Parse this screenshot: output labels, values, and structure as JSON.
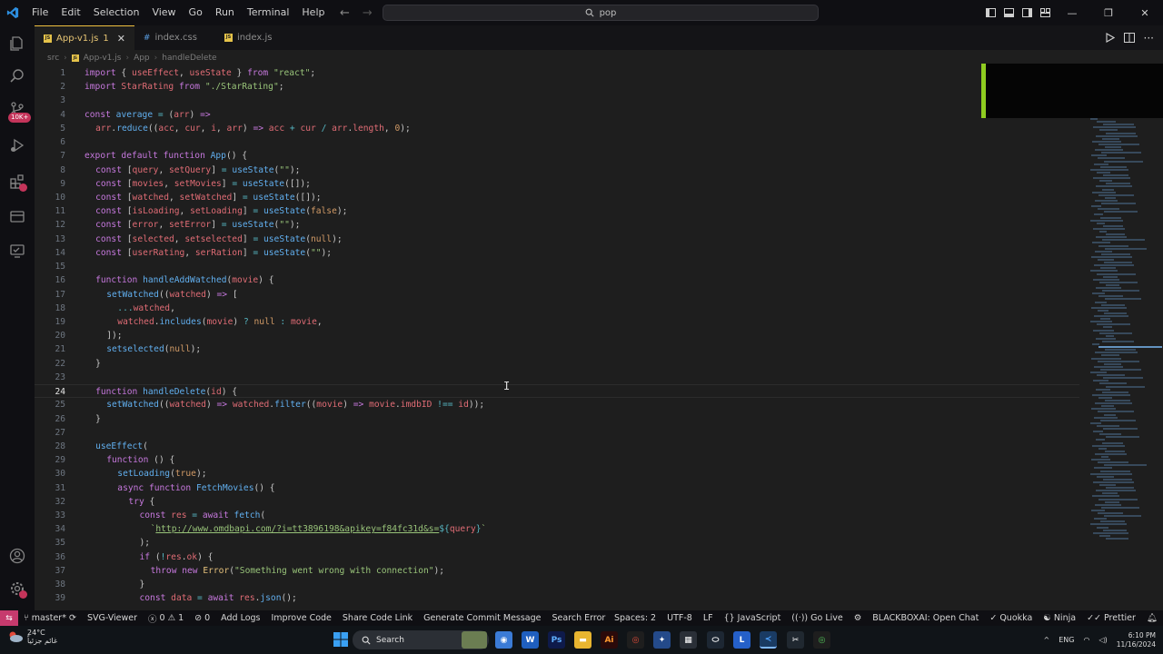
{
  "titlebar": {
    "menu": [
      "File",
      "Edit",
      "Selection",
      "View",
      "Go",
      "Run",
      "Terminal",
      "Help"
    ],
    "search_text": "pop"
  },
  "activity": {
    "badge_source": "10K+"
  },
  "tabs": [
    {
      "label": "App-v1.js",
      "modified": "1",
      "type": "js",
      "active": true
    },
    {
      "label": "index.css",
      "type": "css",
      "active": false
    },
    {
      "label": "index.js",
      "type": "js",
      "active": false
    }
  ],
  "breadcrumb": [
    "src",
    "App-v1.js",
    "App",
    "handleDelete"
  ],
  "editor": {
    "current_line": 24,
    "lines": [
      {
        "n": 1,
        "i": 0,
        "t": [
          [
            "kw",
            "import"
          ],
          [
            "df",
            " { "
          ],
          [
            "vr",
            "useEffect"
          ],
          [
            "df",
            ", "
          ],
          [
            "vr",
            "useState"
          ],
          [
            "df",
            " } "
          ],
          [
            "kw",
            "from"
          ],
          [
            "st",
            " \"react\""
          ],
          [
            "df",
            ";"
          ]
        ]
      },
      {
        "n": 2,
        "i": 0,
        "t": [
          [
            "kw",
            "import"
          ],
          [
            "vr",
            " StarRating "
          ],
          [
            "kw",
            "from"
          ],
          [
            "st",
            " \"./StarRating\""
          ],
          [
            "df",
            ";"
          ]
        ]
      },
      {
        "n": 3,
        "i": 0,
        "t": []
      },
      {
        "n": 4,
        "i": 0,
        "t": [
          [
            "kw",
            "const"
          ],
          [
            "fn",
            " average"
          ],
          [
            "op",
            " = "
          ],
          [
            "df",
            "("
          ],
          [
            "vr",
            "arr"
          ],
          [
            "df",
            ") "
          ],
          [
            "kw",
            "=>"
          ]
        ]
      },
      {
        "n": 5,
        "i": 1,
        "t": [
          [
            "vr",
            "arr"
          ],
          [
            "df",
            "."
          ],
          [
            "fn",
            "reduce"
          ],
          [
            "df",
            "(("
          ],
          [
            "vr",
            "acc"
          ],
          [
            "df",
            ", "
          ],
          [
            "vr",
            "cur"
          ],
          [
            "df",
            ", "
          ],
          [
            "vr",
            "i"
          ],
          [
            "df",
            ", "
          ],
          [
            "vr",
            "arr"
          ],
          [
            "df",
            ") "
          ],
          [
            "kw",
            "=>"
          ],
          [
            "vr",
            " acc "
          ],
          [
            "op",
            "+"
          ],
          [
            "vr",
            " cur "
          ],
          [
            "op",
            "/"
          ],
          [
            "vr",
            " arr"
          ],
          [
            "df",
            "."
          ],
          [
            "vr",
            "length"
          ],
          [
            "df",
            ", "
          ],
          [
            "nu",
            "0"
          ],
          [
            "df",
            ");"
          ]
        ]
      },
      {
        "n": 6,
        "i": 0,
        "t": []
      },
      {
        "n": 7,
        "i": 0,
        "t": [
          [
            "kw",
            "export default function "
          ],
          [
            "fn",
            "App"
          ],
          [
            "df",
            "() {"
          ]
        ]
      },
      {
        "n": 8,
        "i": 1,
        "t": [
          [
            "kw",
            "const"
          ],
          [
            "df",
            " ["
          ],
          [
            "vr",
            "query"
          ],
          [
            "df",
            ", "
          ],
          [
            "vr",
            "setQuery"
          ],
          [
            "df",
            "] "
          ],
          [
            "op",
            "="
          ],
          [
            "fn",
            " useState"
          ],
          [
            "df",
            "("
          ],
          [
            "st",
            "\"\""
          ],
          [
            "df",
            ");"
          ]
        ]
      },
      {
        "n": 9,
        "i": 1,
        "t": [
          [
            "kw",
            "const"
          ],
          [
            "df",
            " ["
          ],
          [
            "vr",
            "movies"
          ],
          [
            "df",
            ", "
          ],
          [
            "vr",
            "setMovies"
          ],
          [
            "df",
            "] "
          ],
          [
            "op",
            "="
          ],
          [
            "fn",
            " useState"
          ],
          [
            "df",
            "([]);"
          ]
        ]
      },
      {
        "n": 10,
        "i": 1,
        "t": [
          [
            "kw",
            "const"
          ],
          [
            "df",
            " ["
          ],
          [
            "vr",
            "watched"
          ],
          [
            "df",
            ", "
          ],
          [
            "vr",
            "setWatched"
          ],
          [
            "df",
            "] "
          ],
          [
            "op",
            "="
          ],
          [
            "fn",
            " useState"
          ],
          [
            "df",
            "([]);"
          ]
        ]
      },
      {
        "n": 11,
        "i": 1,
        "t": [
          [
            "kw",
            "const"
          ],
          [
            "df",
            " ["
          ],
          [
            "vr",
            "isLoading"
          ],
          [
            "df",
            ", "
          ],
          [
            "vr",
            "setLoading"
          ],
          [
            "df",
            "] "
          ],
          [
            "op",
            "="
          ],
          [
            "fn",
            " useState"
          ],
          [
            "df",
            "("
          ],
          [
            "nu",
            "false"
          ],
          [
            "df",
            ");"
          ]
        ]
      },
      {
        "n": 12,
        "i": 1,
        "t": [
          [
            "kw",
            "const"
          ],
          [
            "df",
            " ["
          ],
          [
            "vr",
            "error"
          ],
          [
            "df",
            ", "
          ],
          [
            "vr",
            "setError"
          ],
          [
            "df",
            "] "
          ],
          [
            "op",
            "="
          ],
          [
            "fn",
            " useState"
          ],
          [
            "df",
            "("
          ],
          [
            "st",
            "\"\""
          ],
          [
            "df",
            ");"
          ]
        ]
      },
      {
        "n": 13,
        "i": 1,
        "t": [
          [
            "kw",
            "const"
          ],
          [
            "df",
            " ["
          ],
          [
            "vr",
            "selected"
          ],
          [
            "df",
            ", "
          ],
          [
            "vr",
            "setselected"
          ],
          [
            "df",
            "] "
          ],
          [
            "op",
            "="
          ],
          [
            "fn",
            " useState"
          ],
          [
            "df",
            "("
          ],
          [
            "nu",
            "null"
          ],
          [
            "df",
            ");"
          ]
        ]
      },
      {
        "n": 14,
        "i": 1,
        "t": [
          [
            "kw",
            "const"
          ],
          [
            "df",
            " ["
          ],
          [
            "vr",
            "userRating"
          ],
          [
            "df",
            ", "
          ],
          [
            "vr",
            "serRation"
          ],
          [
            "df",
            "] "
          ],
          [
            "op",
            "="
          ],
          [
            "fn",
            " useState"
          ],
          [
            "df",
            "("
          ],
          [
            "st",
            "\"\""
          ],
          [
            "df",
            ");"
          ]
        ]
      },
      {
        "n": 15,
        "i": 0,
        "t": []
      },
      {
        "n": 16,
        "i": 1,
        "t": [
          [
            "kw",
            "function "
          ],
          [
            "fn",
            "handleAddWatched"
          ],
          [
            "df",
            "("
          ],
          [
            "vr",
            "movie"
          ],
          [
            "df",
            ") {"
          ]
        ]
      },
      {
        "n": 17,
        "i": 2,
        "t": [
          [
            "fn",
            "setWatched"
          ],
          [
            "df",
            "(("
          ],
          [
            "vr",
            "watched"
          ],
          [
            "df",
            ") "
          ],
          [
            "kw",
            "=>"
          ],
          [
            "df",
            " ["
          ]
        ]
      },
      {
        "n": 18,
        "i": 3,
        "t": [
          [
            "op",
            "..."
          ],
          [
            "vr",
            "watched"
          ],
          [
            "df",
            ","
          ]
        ]
      },
      {
        "n": 19,
        "i": 3,
        "t": [
          [
            "vr",
            "watched"
          ],
          [
            "df",
            "."
          ],
          [
            "fn",
            "includes"
          ],
          [
            "df",
            "("
          ],
          [
            "vr",
            "movie"
          ],
          [
            "df",
            ") "
          ],
          [
            "op",
            "?"
          ],
          [
            "nu",
            " null "
          ],
          [
            "op",
            ":"
          ],
          [
            "vr",
            " movie"
          ],
          [
            "df",
            ","
          ]
        ]
      },
      {
        "n": 20,
        "i": 2,
        "t": [
          [
            "df",
            "]);"
          ]
        ]
      },
      {
        "n": 21,
        "i": 2,
        "t": [
          [
            "fn",
            "setselected"
          ],
          [
            "df",
            "("
          ],
          [
            "nu",
            "null"
          ],
          [
            "df",
            ");"
          ]
        ]
      },
      {
        "n": 22,
        "i": 1,
        "t": [
          [
            "df",
            "}"
          ]
        ]
      },
      {
        "n": 23,
        "i": 0,
        "t": []
      },
      {
        "n": 24,
        "i": 1,
        "t": [
          [
            "kw",
            "function "
          ],
          [
            "fn",
            "handleDelete"
          ],
          [
            "df",
            "("
          ],
          [
            "vr",
            "id"
          ],
          [
            "df",
            ") {"
          ]
        ]
      },
      {
        "n": 25,
        "i": 2,
        "t": [
          [
            "fn",
            "setWatched"
          ],
          [
            "df",
            "(("
          ],
          [
            "vr",
            "watched"
          ],
          [
            "df",
            ") "
          ],
          [
            "kw",
            "=>"
          ],
          [
            "vr",
            " watched"
          ],
          [
            "df",
            "."
          ],
          [
            "fn",
            "filter"
          ],
          [
            "df",
            "(("
          ],
          [
            "vr",
            "movie"
          ],
          [
            "df",
            ") "
          ],
          [
            "kw",
            "=>"
          ],
          [
            "vr",
            " movie"
          ],
          [
            "df",
            "."
          ],
          [
            "vr",
            "imdbID"
          ],
          [
            "op",
            " !== "
          ],
          [
            "vr",
            "id"
          ],
          [
            "df",
            "));"
          ]
        ]
      },
      {
        "n": 26,
        "i": 1,
        "t": [
          [
            "df",
            "}"
          ]
        ]
      },
      {
        "n": 27,
        "i": 0,
        "t": []
      },
      {
        "n": 28,
        "i": 1,
        "t": [
          [
            "fn",
            "useEffect"
          ],
          [
            "df",
            "("
          ]
        ]
      },
      {
        "n": 29,
        "i": 2,
        "t": [
          [
            "kw",
            "function "
          ],
          [
            "df",
            "() {"
          ]
        ]
      },
      {
        "n": 30,
        "i": 3,
        "t": [
          [
            "fn",
            "setLoading"
          ],
          [
            "df",
            "("
          ],
          [
            "nu",
            "true"
          ],
          [
            "df",
            ");"
          ]
        ]
      },
      {
        "n": 31,
        "i": 3,
        "t": [
          [
            "kw",
            "async function "
          ],
          [
            "fn",
            "FetchMovies"
          ],
          [
            "df",
            "() {"
          ]
        ]
      },
      {
        "n": 32,
        "i": 4,
        "t": [
          [
            "kw",
            "try"
          ],
          [
            "df",
            " {"
          ]
        ]
      },
      {
        "n": 33,
        "i": 5,
        "t": [
          [
            "kw",
            "const"
          ],
          [
            "vr",
            " res "
          ],
          [
            "op",
            "="
          ],
          [
            "kw",
            " await "
          ],
          [
            "fn",
            "fetch"
          ],
          [
            "df",
            "("
          ]
        ]
      },
      {
        "n": 34,
        "i": 6,
        "t": [
          [
            "st",
            "`"
          ],
          [
            "st ul",
            "http://www.omdbapi.com/?i=tt3896198&apikey=f84fc31d&s="
          ],
          [
            "op",
            "${"
          ],
          [
            "vr",
            "query"
          ],
          [
            "op",
            "}"
          ],
          [
            "st",
            "`"
          ]
        ]
      },
      {
        "n": 35,
        "i": 5,
        "t": [
          [
            "df",
            ");"
          ]
        ]
      },
      {
        "n": 36,
        "i": 5,
        "t": [
          [
            "kw",
            "if"
          ],
          [
            "df",
            " ("
          ],
          [
            "op",
            "!"
          ],
          [
            "vr",
            "res"
          ],
          [
            "df",
            "."
          ],
          [
            "vr",
            "ok"
          ],
          [
            "df",
            ") {"
          ]
        ]
      },
      {
        "n": 37,
        "i": 6,
        "t": [
          [
            "kw",
            "throw new "
          ],
          [
            "ty",
            "Error"
          ],
          [
            "df",
            "("
          ],
          [
            "st",
            "\"Something went wrong with connection\""
          ],
          [
            "df",
            ");"
          ]
        ]
      },
      {
        "n": 38,
        "i": 5,
        "t": [
          [
            "df",
            "}"
          ]
        ]
      },
      {
        "n": 39,
        "i": 5,
        "t": [
          [
            "kw",
            "const"
          ],
          [
            "vr",
            " data "
          ],
          [
            "op",
            "="
          ],
          [
            "kw",
            " await "
          ],
          [
            "vr",
            "res"
          ],
          [
            "df",
            "."
          ],
          [
            "fn",
            "json"
          ],
          [
            "df",
            "();"
          ]
        ]
      }
    ]
  },
  "statusbar": {
    "branch": "master*",
    "svg_viewer": "SVG-Viewer",
    "errors": "0",
    "warnings": "1",
    "ports": "0",
    "items_left": [
      "Add Logs",
      "Improve Code",
      "Share Code Link",
      "Generate Commit Message",
      "Search Error"
    ],
    "spaces": "Spaces: 2",
    "encoding": "UTF-8",
    "eol": "LF",
    "language": "JavaScript",
    "golive": "Go Live",
    "blackbox": "BLACKBOXAI: Open Chat",
    "quokka": "Quokka",
    "ninja": "Ninja",
    "prettier": "Prettier"
  },
  "taskbar": {
    "temp": "24°C",
    "weather": "غائم جزئياً",
    "search": "Search",
    "lang": "ENG",
    "time": "6:10 PM",
    "date": "11/16/2024"
  }
}
